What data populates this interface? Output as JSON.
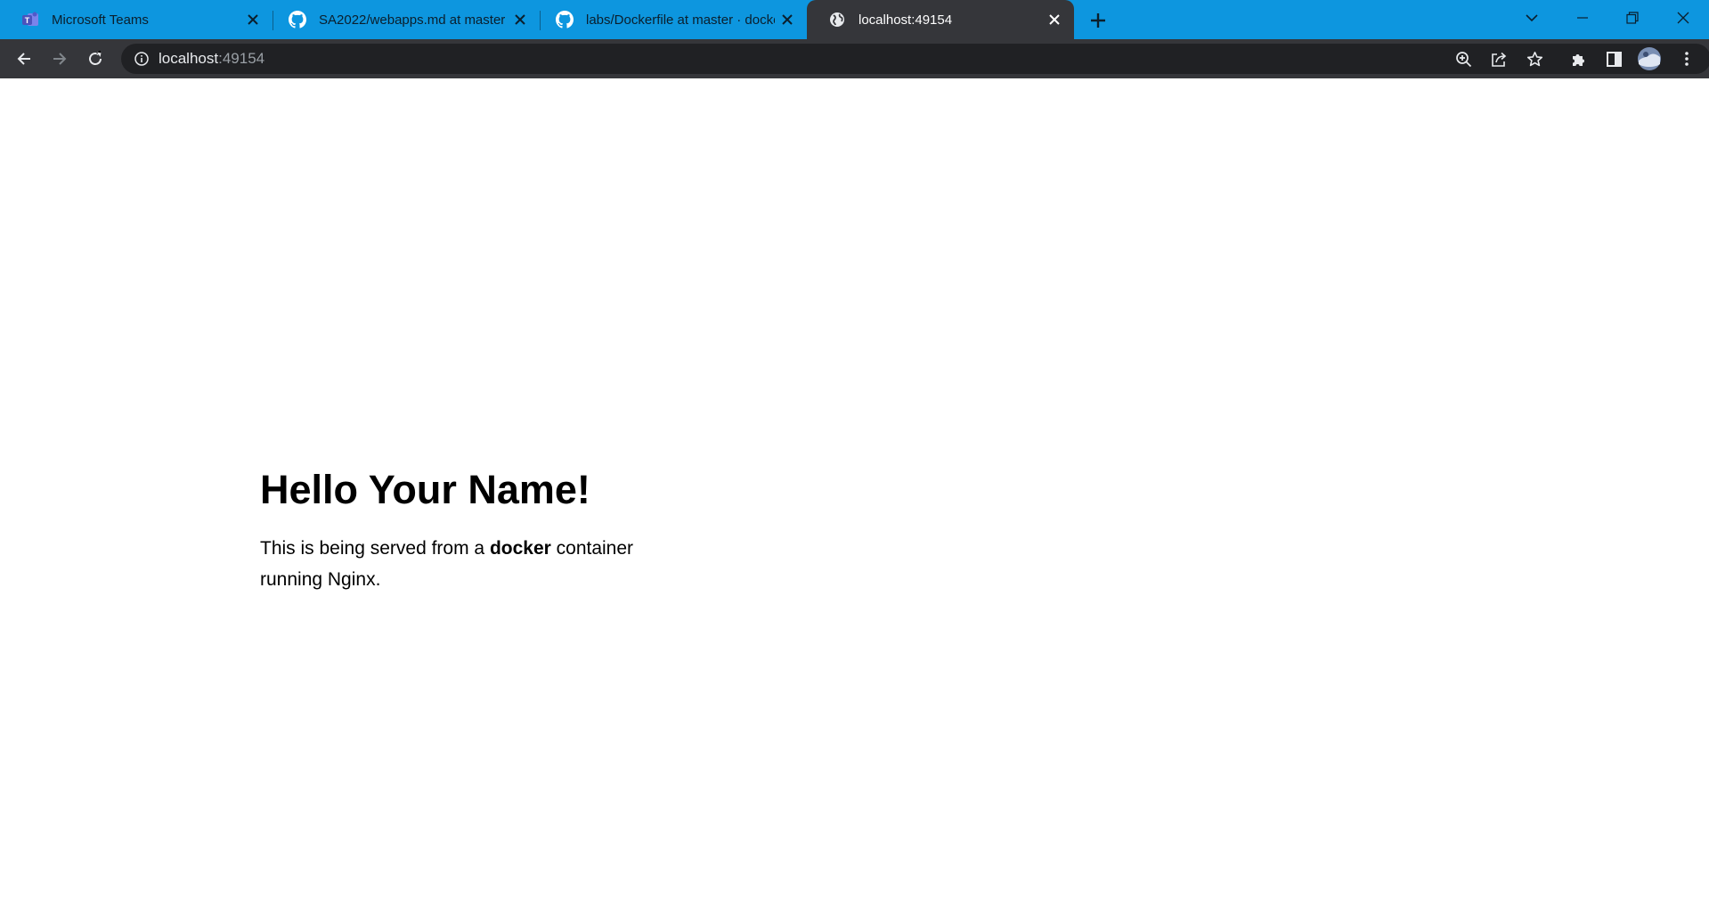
{
  "browser": {
    "tabs": [
      {
        "title": "Microsoft Teams",
        "icon": "teams-icon",
        "active": false
      },
      {
        "title": "SA2022/webapps.md at master ·",
        "icon": "github-icon",
        "active": false
      },
      {
        "title": "labs/Dockerfile at master · docke",
        "icon": "github-icon",
        "active": false
      },
      {
        "title": "localhost:49154",
        "icon": "globe-icon",
        "active": true
      }
    ],
    "omnibox": {
      "host": "localhost",
      "port": ":49154"
    },
    "colors": {
      "tabstrip": "#0d96df",
      "toolbar": "#35363a",
      "omnibox": "#202124"
    }
  },
  "page": {
    "heading": "Hello Your Name!",
    "paragraph": {
      "prefix": "This is being served from a ",
      "strong": "docker",
      "suffix": " container running Nginx."
    }
  }
}
